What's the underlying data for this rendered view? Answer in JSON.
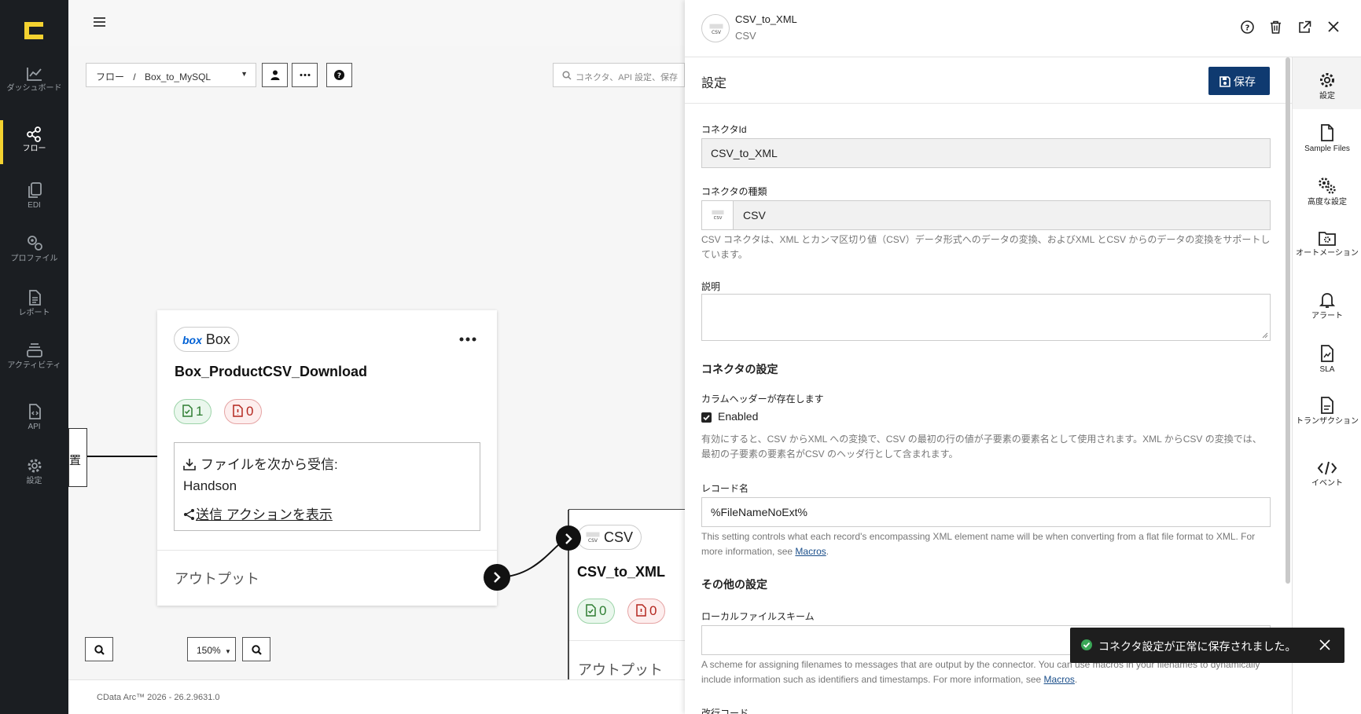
{
  "colors": {
    "accent": "#f4d230",
    "primary": "#0f3a70",
    "nav_bg": "#1b1e22",
    "toast_bg": "#1e1e1e",
    "success": "#2e7d32",
    "error": "#b3261e"
  },
  "nav": {
    "items": [
      {
        "label": "ダッシュボード",
        "icon": "dashboard-icon"
      },
      {
        "label": "フロー",
        "icon": "flow-icon",
        "active": true
      },
      {
        "label": "EDI",
        "icon": "edi-icon"
      },
      {
        "label": "プロファイル",
        "icon": "profile-icon"
      },
      {
        "label": "レポート",
        "icon": "report-icon"
      },
      {
        "label": "アクティビティ",
        "icon": "activity-icon"
      },
      {
        "label": "API",
        "icon": "api-icon"
      },
      {
        "label": "設定",
        "icon": "settings-icon"
      }
    ]
  },
  "toolbar": {
    "breadcrumb_root": "フロー",
    "breadcrumb_sep": "/",
    "breadcrumb_current": "Box_to_MySQL",
    "search_placeholder": "コネクタ、API 設定、保存"
  },
  "nodes": {
    "box": {
      "chip_label": "Box",
      "brand": "box",
      "title": "Box_ProductCSV_Download",
      "ok_count": "1",
      "err_count": "0",
      "receive_label": "ファイルを次から受信:",
      "receive_from": "Handson",
      "send_link": "送信 アクションを表示",
      "output_label": "アウトプット"
    },
    "csv": {
      "chip_label": "CSV",
      "title": "CSV_to_XML",
      "ok_count": "0",
      "err_count": "0",
      "output_label": "アウトプット"
    },
    "left_partial": "置"
  },
  "zoom": {
    "value": "150%"
  },
  "footer": {
    "version": "CData Arc™ 2026 - 26.2.9631.0"
  },
  "panel": {
    "connector_name": "CSV_to_XML",
    "connector_type": "CSV",
    "settings_title": "設定",
    "save_label": "保存",
    "fields": {
      "connector_id_label": "コネクタId",
      "connector_id_value": "CSV_to_XML",
      "connector_type_label": "コネクタの種類",
      "connector_type_value": "CSV",
      "connector_type_help": "CSV コネクタは、XML とカンマ区切り値（CSV）データ形式へのデータの変換、およびXML とCSV からのデータの変換をサポートしています。",
      "description_label": "説明",
      "connector_settings_title": "コネクタの設定",
      "header_exists_label": "カラムヘッダーが存在します",
      "enabled_label": "Enabled",
      "header_help": "有効にすると、CSV からXML への変換で、CSV の最初の行の値が子要素の要素名として使用されます。XML からCSV の変換では、最初の子要素の要素名がCSV のヘッダ行として含まれます。",
      "record_name_label": "レコード名",
      "record_name_value": "%FileNameNoExt%",
      "record_help": "This setting controls what each record's encompassing XML element name will be when converting from a flat file format to XML. For more information, see",
      "record_help_link": "Macros",
      "other_settings_title": "その他の設定",
      "local_scheme_label": "ローカルファイルスキーム",
      "local_scheme_help": "A scheme for assigning filenames to messages that are output by the connector. You can use macros in your filenames to dynamically include information such as identifiers and timestamps. For more information, see",
      "local_scheme_link": "Macros",
      "next_label_partial": "改行コード"
    },
    "side_tabs": [
      {
        "label": "設定",
        "icon": "gear-icon",
        "active": true
      },
      {
        "label": "Sample Files",
        "icon": "file-icon"
      },
      {
        "label": "高度な設定",
        "icon": "gears-icon"
      },
      {
        "label": "オートメーション",
        "icon": "folder-gear-icon"
      },
      {
        "label": "アラート",
        "icon": "bell-icon"
      },
      {
        "label": "SLA",
        "icon": "sla-icon"
      },
      {
        "label": "トランザクション",
        "icon": "transaction-icon"
      },
      {
        "label": "イベント",
        "icon": "code-icon"
      }
    ]
  },
  "toast": {
    "message": "コネクタ設定が正常に保存されました。"
  }
}
